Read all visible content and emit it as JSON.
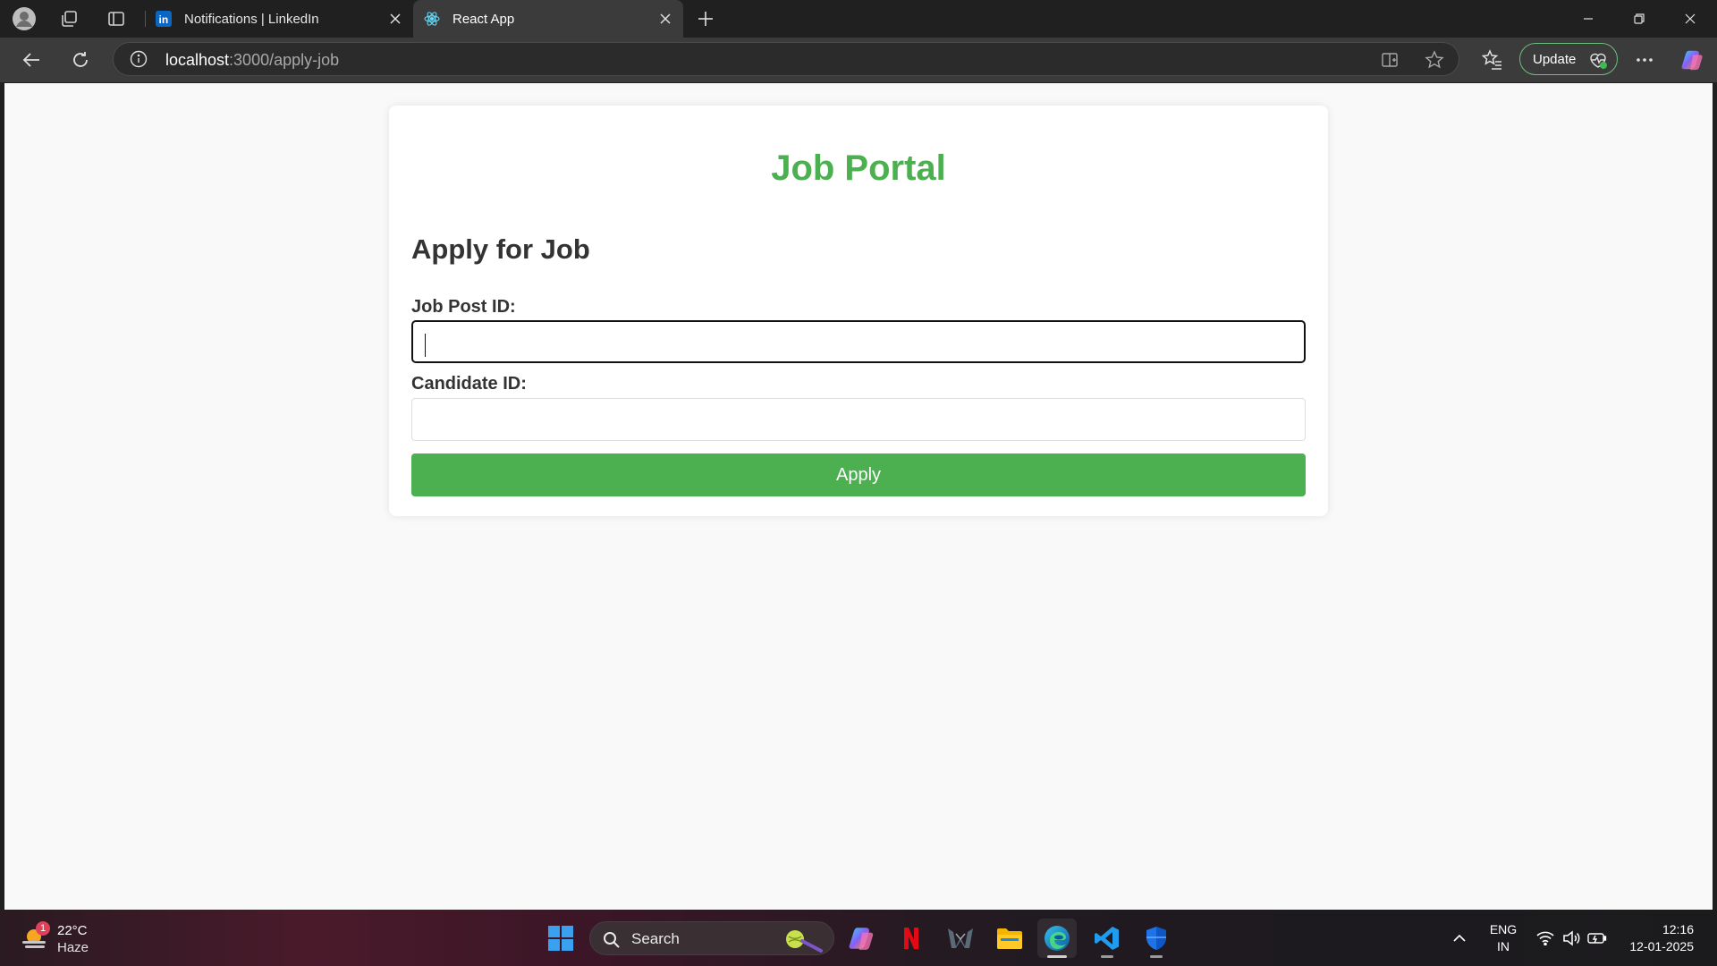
{
  "browser": {
    "tabs": [
      {
        "label": "Notifications | LinkedIn",
        "favicon": "linkedin-icon",
        "active": false
      },
      {
        "label": "React App",
        "favicon": "react-icon",
        "active": true
      }
    ],
    "url_host": "localhost",
    "url_path": ":3000/apply-job",
    "update_label": "Update"
  },
  "page": {
    "portal_title": "Job Portal",
    "form_title": "Apply for Job",
    "job_post_label": "Job Post ID:",
    "job_post_value": "",
    "candidate_label": "Candidate ID:",
    "candidate_value": "",
    "apply_label": "Apply"
  },
  "colors": {
    "accent_green": "#4caf50",
    "heading_text": "#333333"
  },
  "taskbar": {
    "weather_temp": "22°C",
    "weather_condition": "Haze",
    "weather_badge": "1",
    "search_placeholder": "Search",
    "lang_line1": "ENG",
    "lang_line2": "IN",
    "time": "12:16",
    "date": "12-01-2025"
  }
}
